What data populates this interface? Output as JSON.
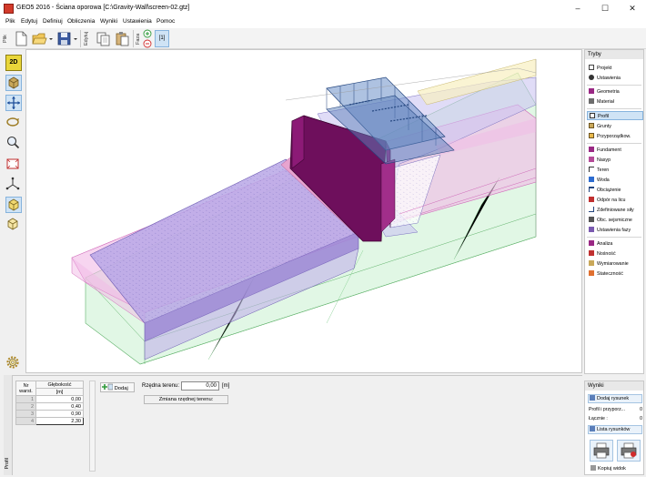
{
  "window": {
    "title": "GEO5 2016 - Ściana oporowa [C:\\Gravity-Wall\\screen-02.gtz]",
    "minimize": "–",
    "maximize": "☐",
    "close": "✕"
  },
  "menu": [
    "Plik",
    "Edytuj",
    "Definiuj",
    "Obliczenia",
    "Wyniki",
    "Ustawienia",
    "Pomoc"
  ],
  "toolbar": {
    "section_file": "Plik",
    "section_edit": "Edytuj",
    "section_phase": "Faza",
    "phase_number": "[1]"
  },
  "modes": {
    "header": "Tryby",
    "items": [
      "Projekt",
      "Ustawienia",
      "Geometria",
      "Materiał",
      "Profil",
      "Grunty",
      "Przyporządkow.",
      "Fundament",
      "Nasyp",
      "Teren",
      "Woda",
      "Obciążenie",
      "Odpór na licu",
      "Zdefiniowane siły",
      "Obc. sejsmiczne",
      "Ustawienia fazy",
      "Analiza",
      "Nośność",
      "Wymiarowanie",
      "Stateczność"
    ],
    "active_index": 4
  },
  "layers_table": {
    "col_number": "Nr warst.",
    "col_depth": "Głębokość",
    "col_depth_unit": "[m]",
    "rows": [
      {
        "num": "1",
        "depth": "0,00"
      },
      {
        "num": "2",
        "depth": "0,40"
      },
      {
        "num": "3",
        "depth": "0,90"
      },
      {
        "num": "4",
        "depth": "2,30"
      }
    ]
  },
  "bottom": {
    "side_tab": "Profil",
    "add_button": "Dodaj",
    "terrain_label": "Rzędna terenu:",
    "terrain_value": "0,00",
    "terrain_unit": "[m]",
    "terrain_change_button": "Zmiana rzędnej terenu:"
  },
  "results": {
    "header": "Wyniki",
    "add_figure": "Dodaj rysunek",
    "profile_label": "Profil i przyporz...",
    "profile_value": "0",
    "total_label": "Łącznie :",
    "total_value": "0",
    "figures_list": "Lista rysunków",
    "copy_view": "Kopiuj widok"
  },
  "left_tools": {
    "mode_2d": "2D"
  },
  "colors": {
    "accent": "#cfe3f5",
    "wall": "#6e0f5c",
    "soil_layer_1": "#b9a7e6",
    "soil_layer_2": "#f2b9e6",
    "soil_layer_3": "#c8f0cf"
  }
}
